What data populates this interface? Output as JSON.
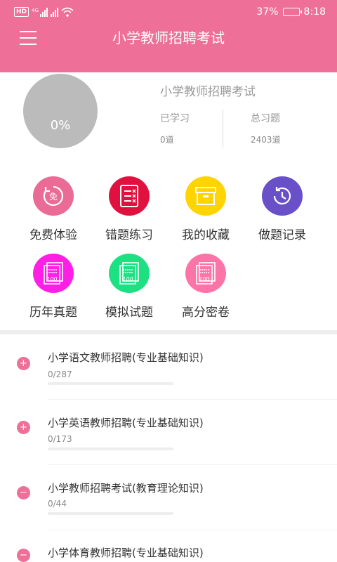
{
  "status_bar": {
    "network_badge": "HD",
    "signal_label": "4G",
    "battery": "37%",
    "battery_level": 0.37,
    "time": "8:18"
  },
  "header": {
    "title": "小学教师招聘考试"
  },
  "summary": {
    "progress": "0%",
    "exam_name": "小学教师招聘考试",
    "learned_label": "已学习",
    "learned_value": "0道",
    "total_label": "总习题",
    "total_value": "2403道"
  },
  "grid": [
    {
      "label": "免费体验",
      "icon": "free-icon",
      "color": "#ea6b96"
    },
    {
      "label": "错题练习",
      "icon": "wrong-list-icon",
      "color": "#e0103f"
    },
    {
      "label": "我的收藏",
      "icon": "archive-box-icon",
      "color": "#ffd400"
    },
    {
      "label": "做题记录",
      "icon": "clock-history-icon",
      "color": "#6a50c8"
    },
    {
      "label": "历年真题",
      "icon": "exam-paper-icon",
      "color": "#ff1ee6"
    },
    {
      "label": "模拟试题",
      "icon": "exam-paper-icon",
      "color": "#1ce082"
    },
    {
      "label": "高分密卷",
      "icon": "exam-paper-icon",
      "color": "#ff74a8"
    }
  ],
  "list": [
    {
      "title": "小学语文教师招聘(专业基础知识)",
      "count": "0/287",
      "toggle": "+",
      "progress": 0
    },
    {
      "title": "小学英语教师招聘(专业基础知识)",
      "count": "0/173",
      "toggle": "+",
      "progress": 0
    },
    {
      "title": "小学教师招聘考试(教育理论知识)",
      "count": "0/44",
      "toggle": "−",
      "progress": 0
    },
    {
      "title": "小学体育教师招聘(专业基础知识)",
      "count": "",
      "toggle": "−",
      "progress": 0
    }
  ]
}
